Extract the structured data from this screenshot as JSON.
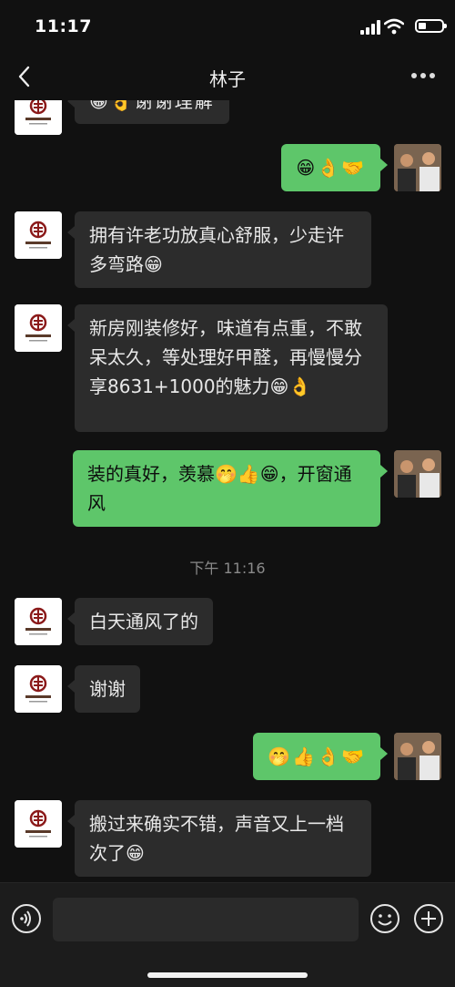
{
  "status": {
    "time": "11:17"
  },
  "header": {
    "title": "林子"
  },
  "messages": {
    "m0": "😁👌谢谢理解",
    "m1": "😁👌🤝",
    "m2": "拥有许老功放真心舒服，少走许多弯路😁",
    "m3": "新房刚装修好，味道有点重，不敢呆太久，等处理好甲醛，再慢慢分享8631+1000的魅力😁👌",
    "m4": "装的真好，羡慕🤭👍😁，开窗通风",
    "timestamp": "下午 11:16",
    "m5": "白天通风了的",
    "m6": "谢谢",
    "m7": "🤭👍👌🤝",
    "m8": "搬过来确实不错，声音又上一档次了😁"
  },
  "colors": {
    "accent": "#5ec66a",
    "incoming": "#2c2c2c",
    "background": "#111111"
  }
}
